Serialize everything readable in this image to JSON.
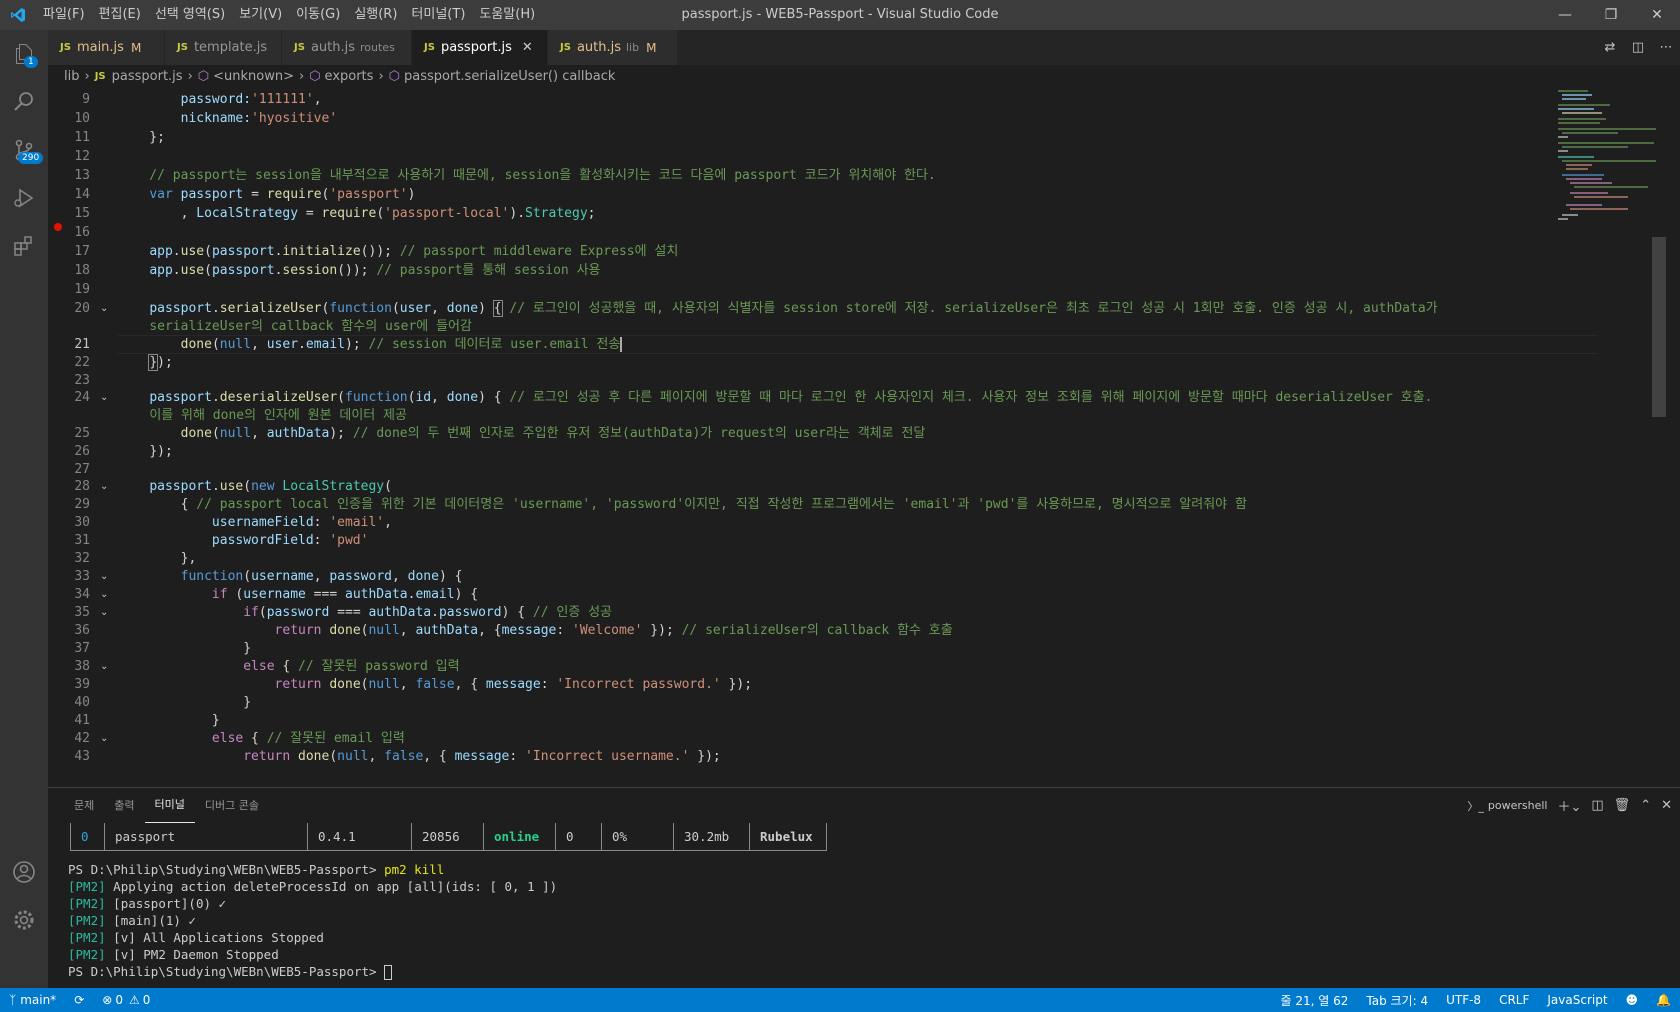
{
  "window": {
    "title": "passport.js - WEB5-Passport - Visual Studio Code",
    "menu": [
      "파일(F)",
      "편집(E)",
      "선택 영역(S)",
      "보기(V)",
      "이동(G)",
      "실행(R)",
      "터미널(T)",
      "도움말(H)"
    ]
  },
  "activity": {
    "explorer_badge": "1",
    "scm_badge": "290"
  },
  "tabs": [
    {
      "label": "main.js",
      "desc": "",
      "mod": "M",
      "active": false
    },
    {
      "label": "template.js",
      "desc": "",
      "mod": "",
      "active": false
    },
    {
      "label": "auth.js",
      "desc": "routes",
      "mod": "",
      "active": false
    },
    {
      "label": "passport.js",
      "desc": "",
      "mod": "",
      "active": true
    },
    {
      "label": "auth.js",
      "desc": "lib",
      "mod": "M",
      "active": false
    }
  ],
  "breadcrumb": [
    "lib",
    "passport.js",
    "<unknown>",
    "exports",
    "passport.serializeUser() callback"
  ],
  "editor": {
    "lines": [
      "9",
      "10",
      "11",
      "12",
      "13",
      "14",
      "15",
      "16",
      "17",
      "18",
      "19",
      "20",
      "",
      "21",
      "22",
      "23",
      "24",
      "",
      "25",
      "26",
      "27",
      "28",
      "29",
      "30",
      "31",
      "32",
      "33",
      "34",
      "35",
      "36",
      "37",
      "38",
      "39",
      "40",
      "41",
      "42",
      "43"
    ]
  },
  "code": {
    "l9a": "        password:",
    "l9b": "'111111'",
    "l9c": ",",
    "l10a": "        nickname:",
    "l10b": "'hyositive'",
    "l11": "    };",
    "l13": "    // passport는 session을 내부적으로 사용하기 때문에, session을 활성화시키는 코드 다음에 passport 코드가 위치해야 한다.",
    "l14a": "var",
    "l14b": "passport",
    "l14c": " = ",
    "l14d": "require",
    "l14e": "'passport'",
    "l15a": "    , ",
    "l15b": "LocalStrategy",
    "l15c": " = ",
    "l15d": "require",
    "l15e": "'passport-local'",
    "l15f": "Strategy",
    "l17a": "app",
    "l17b": "use",
    "l17c": "passport",
    "l17d": "initialize",
    "l17e": "// passport middleware Express에 설치",
    "l18a": "app",
    "l18b": "use",
    "l18c": "passport",
    "l18d": "session",
    "l18e": "// passport를 통해 session 사용",
    "l20a": "passport",
    "l20b": "serializeUser",
    "l20c": "function",
    "l20d": "user",
    "l20e": "done",
    "l20f": "// 로그인이 성공했을 때, 사용자의 식별자를 session store에 저장. serializeUser은 최초 로그인 성공 시 1회만 호출. 인증 성공 시, authData가",
    "l20g": "serializeUser의 callback 함수의 user에 들어감",
    "l21a": "done",
    "l21b": "null",
    "l21c": "user",
    "l21d": "email",
    "l21e": "// session 데이터로 user.email 전송",
    "l22": "});",
    "l24a": "passport",
    "l24b": "deserializeUser",
    "l24c": "function",
    "l24d": "id",
    "l24e": "done",
    "l24f": "// 로그인 성공 후 다른 페이지에 방문할 때 마다 로그인 한 사용자인지 체크. 사용자 정보 조회를 위해 페이지에 방문할 때마다 deserializeUser 호출.",
    "l24g": "이를 위해 done의 인자에 원본 데이터 제공",
    "l25a": "done",
    "l25b": "null",
    "l25c": "authData",
    "l25d": "// done의 두 번째 인자로 주입한 유저 정보(authData)가 request의 user라는 객체로 전달",
    "l26": "});",
    "l28a": "passport",
    "l28b": "use",
    "l28c": "new",
    "l28d": "LocalStrategy",
    "l29a": "{ ",
    "l29b": "// passport local 인증을 위한 기본 데이터명은 'username', 'password'이지만, 직접 작성한 프로그램에서는 'email'과 'pwd'를 사용하므로, 명시적으로 알려줘야 함",
    "l30a": "usernameField",
    "l30b": "'email'",
    "l31a": "passwordField",
    "l31b": "'pwd'",
    "l32": "},",
    "l33a": "function",
    "l33b": "username",
    "l33c": "password",
    "l33d": "done",
    "l34a": "if",
    "l34b": "username",
    "l34c": "authData",
    "l34d": "email",
    "l35a": "if",
    "l35b": "password",
    "l35c": "authData",
    "l35d": "password",
    "l35e": "// 인증 성공",
    "l36a": "return",
    "l36b": "done",
    "l36c": "null",
    "l36d": "authData",
    "l36e": "message",
    "l36f": "'Welcome'",
    "l36g": "// serializeUser의 callback 함수 호출",
    "l37": "}",
    "l38a": "else",
    "l38b": "// 잘못된 password 입력",
    "l39a": "return",
    "l39b": "done",
    "l39c": "null",
    "l39d": "false",
    "l39e": "message",
    "l39f": "'Incorrect password.'",
    "l40": "}",
    "l41": "}",
    "l42a": "else",
    "l42b": "// 잘못된 email 입력",
    "l43a": "return",
    "l43b": "done",
    "l43c": "null",
    "l43d": "false",
    "l43e": "message",
    "l43f": "'Incorrect username.'"
  },
  "panel": {
    "tabs": [
      "문제",
      "출력",
      "터미널",
      "디버그 콘솔"
    ],
    "shell": "powershell",
    "pm2_table": [
      "0",
      "passport",
      "0.4.1",
      "20856",
      "online",
      "0",
      "0%",
      "30.2mb",
      "Rubelux"
    ],
    "terminal": [
      {
        "prefix": "",
        "text": "PS D:\\Philip\\Studying\\WEBn\\WEB5-Passport> ",
        "cmd": "pm2 kill"
      },
      {
        "prefix": "[PM2]",
        "text": " Applying action deleteProcessId on app [all](ids: [ 0, 1 ])",
        "cmd": ""
      },
      {
        "prefix": "[PM2]",
        "text": " [passport](0) ✓",
        "cmd": ""
      },
      {
        "prefix": "[PM2]",
        "text": " [main](1) ✓",
        "cmd": ""
      },
      {
        "prefix": "[PM2]",
        "text": " [v] All Applications Stopped",
        "cmd": ""
      },
      {
        "prefix": "[PM2]",
        "text": " [v] PM2 Daemon Stopped",
        "cmd": ""
      },
      {
        "prefix": "",
        "text": "PS D:\\Philip\\Studying\\WEBn\\WEB5-Passport> ",
        "cmd": ""
      }
    ]
  },
  "status": {
    "branch": "main*",
    "errors": "0",
    "warnings": "0",
    "position": "줄 21, 열 62",
    "tab": "Tab 크기: 4",
    "encoding": "UTF-8",
    "eol": "CRLF",
    "language": "JavaScript"
  },
  "colors": {
    "accent": "#007acc",
    "pm2": "#2db7a3",
    "online": "#23d18b"
  }
}
